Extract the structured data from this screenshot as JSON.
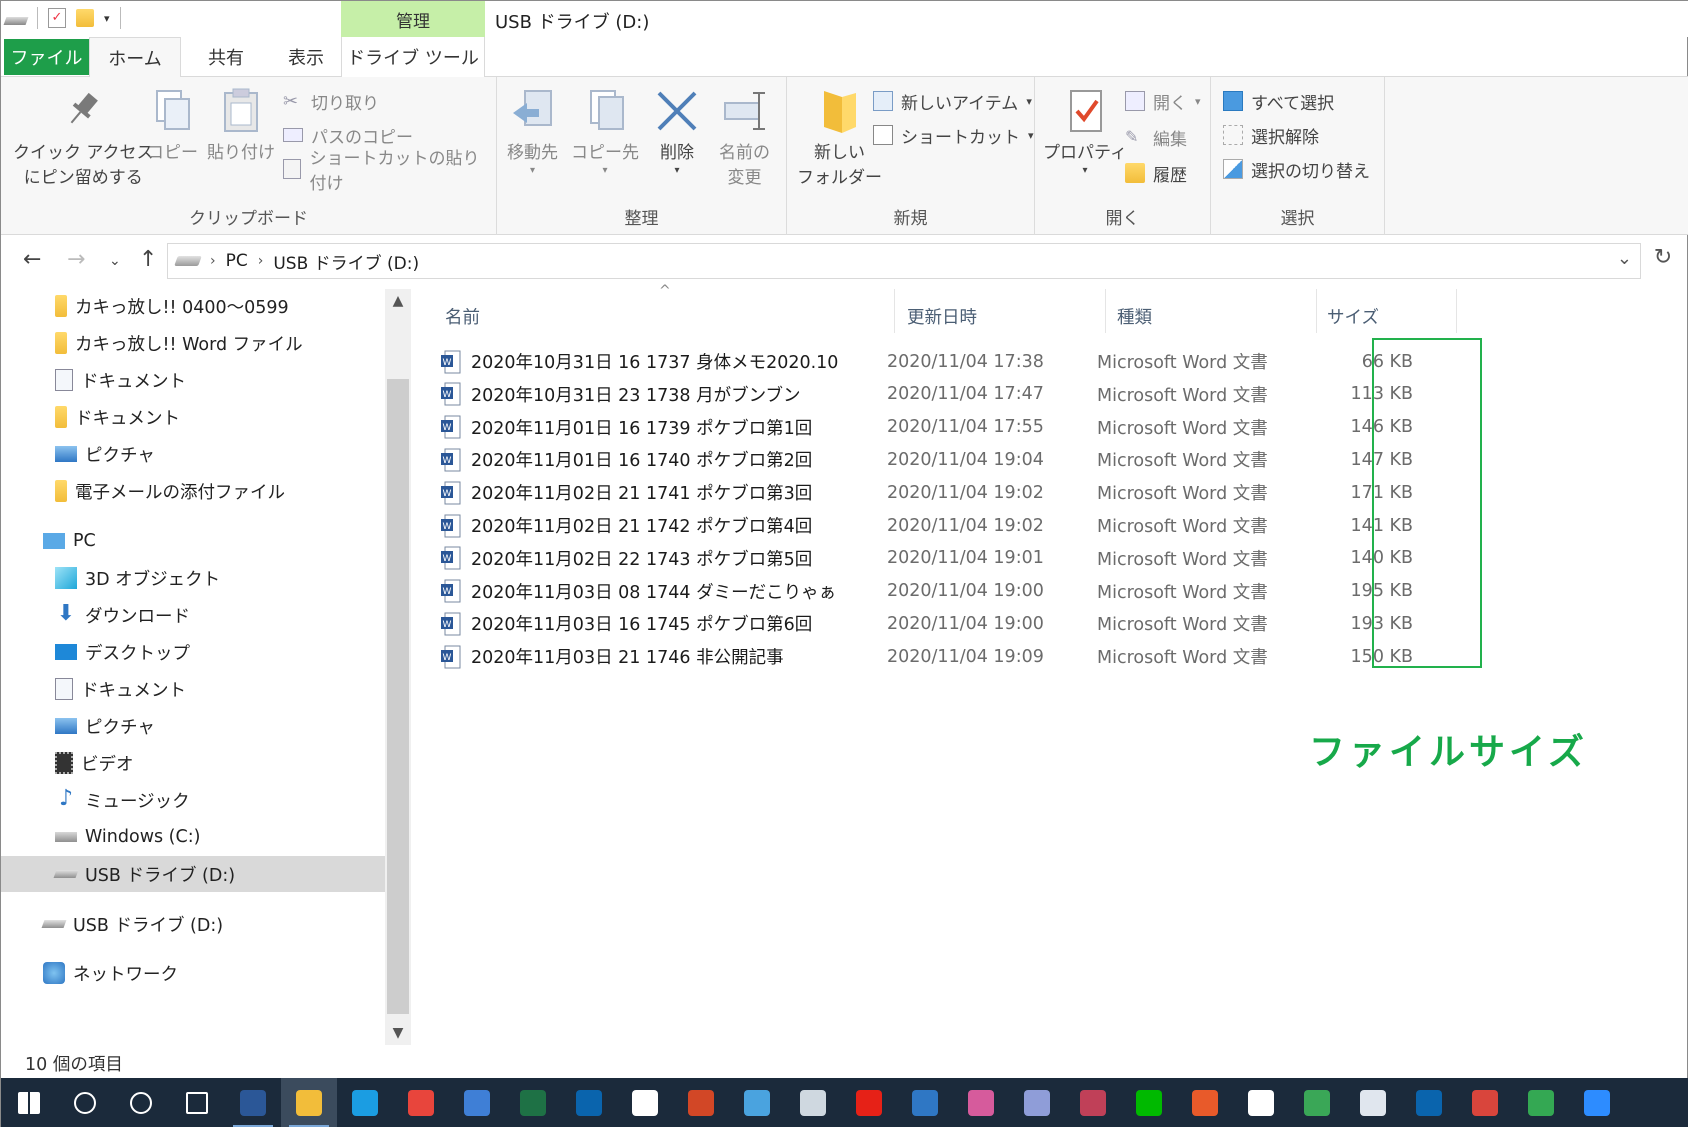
{
  "window": {
    "title": "USB ドライブ (D:)",
    "context_tab": "管理"
  },
  "tabs": {
    "file": "ファイル",
    "home": "ホーム",
    "share": "共有",
    "view": "表示",
    "drive_tools": "ドライブ ツール"
  },
  "ribbon": {
    "clipboard": {
      "pin_line1": "クイック アクセス",
      "pin_line2": "にピン留めする",
      "copy": "コピー",
      "paste": "貼り付け",
      "cut": "切り取り",
      "copy_path": "パスのコピー",
      "paste_shortcut": "ショートカットの貼り付け",
      "label": "クリップボード"
    },
    "organize": {
      "move_to": "移動先",
      "copy_to": "コピー先",
      "delete": "削除",
      "rename_line1": "名前の",
      "rename_line2": "変更",
      "label": "整理"
    },
    "new": {
      "new_folder_line1": "新しい",
      "new_folder_line2": "フォルダー",
      "new_item": "新しいアイテム",
      "shortcut": "ショートカット",
      "label": "新規"
    },
    "open": {
      "properties": "プロパティ",
      "open": "開く",
      "edit": "編集",
      "history": "履歴",
      "label": "開く"
    },
    "select": {
      "select_all": "すべて選択",
      "select_none": "選択解除",
      "invert": "選択の切り替え",
      "label": "選択"
    }
  },
  "address": {
    "crumbs": [
      "PC",
      "USB ドライブ (D:)"
    ]
  },
  "nav": {
    "items": [
      {
        "label": "カキっ放し!! 0400～0599",
        "icon": "folder-icon"
      },
      {
        "label": "カキっ放し!! Word ファイル",
        "icon": "folder-icon"
      },
      {
        "label": "ドキュメント",
        "icon": "document-icon"
      },
      {
        "label": "ドキュメント",
        "icon": "folder-icon"
      },
      {
        "label": "ピクチャ",
        "icon": "picture-icon"
      },
      {
        "label": "電子メールの添付ファイル",
        "icon": "folder-icon"
      },
      {
        "label": "PC",
        "icon": "pc-icon"
      },
      {
        "label": "3D オブジェクト",
        "icon": "cube-icon"
      },
      {
        "label": "ダウンロード",
        "icon": "download-icon"
      },
      {
        "label": "デスクトップ",
        "icon": "desktop-icon"
      },
      {
        "label": "ドキュメント",
        "icon": "document-icon"
      },
      {
        "label": "ピクチャ",
        "icon": "picture-icon"
      },
      {
        "label": "ビデオ",
        "icon": "video-icon"
      },
      {
        "label": "ミュージック",
        "icon": "music-icon"
      },
      {
        "label": "Windows (C:)",
        "icon": "windows-drive-icon"
      },
      {
        "label": "USB ドライブ (D:)",
        "icon": "usb-drive-icon"
      },
      {
        "label": "USB ドライブ (D:)",
        "icon": "usb-drive-icon"
      },
      {
        "label": "ネットワーク",
        "icon": "network-icon"
      }
    ]
  },
  "columns": {
    "name": "名前",
    "date": "更新日時",
    "type": "種類",
    "size": "サイズ"
  },
  "files": [
    {
      "name": "2020年10月31日 16 1737 身体メモ2020.10",
      "date": "2020/11/04 17:38",
      "type": "Microsoft Word 文書",
      "size": "66 KB"
    },
    {
      "name": "2020年10月31日 23 1738 月がブンブン",
      "date": "2020/11/04 17:47",
      "type": "Microsoft Word 文書",
      "size": "113 KB"
    },
    {
      "name": "2020年11月01日 16 1739 ポケブロ第1回",
      "date": "2020/11/04 17:55",
      "type": "Microsoft Word 文書",
      "size": "146 KB"
    },
    {
      "name": "2020年11月01日 16 1740 ポケブロ第2回",
      "date": "2020/11/04 19:04",
      "type": "Microsoft Word 文書",
      "size": "147 KB"
    },
    {
      "name": "2020年11月02日 21 1741 ポケブロ第3回",
      "date": "2020/11/04 19:02",
      "type": "Microsoft Word 文書",
      "size": "171 KB"
    },
    {
      "name": "2020年11月02日 21 1742 ポケブロ第4回",
      "date": "2020/11/04 19:02",
      "type": "Microsoft Word 文書",
      "size": "141 KB"
    },
    {
      "name": "2020年11月02日 22 1743 ポケブロ第5回",
      "date": "2020/11/04 19:01",
      "type": "Microsoft Word 文書",
      "size": "140 KB"
    },
    {
      "name": "2020年11月03日 08 1744 ダミーだこりゃぁ",
      "date": "2020/11/04 19:00",
      "type": "Microsoft Word 文書",
      "size": "195 KB"
    },
    {
      "name": "2020年11月03日 16 1745 ポケブロ第6回",
      "date": "2020/11/04 19:00",
      "type": "Microsoft Word 文書",
      "size": "193 KB"
    },
    {
      "name": "2020年11月03日 21 1746 非公開記事",
      "date": "2020/11/04 19:09",
      "type": "Microsoft Word 文書",
      "size": "150 KB"
    }
  ],
  "annotation": "ファイルサイズ",
  "status": "10 個の項目",
  "colors": {
    "file_tab": "#1e9e4a",
    "context_tab": "#c6efa8",
    "annotation": "#17a94a",
    "selection": "#d9d9d9",
    "taskbar": "#1b2a3b"
  },
  "taskbar": [
    "windows-start-icon",
    "search-icon",
    "cortana-icon",
    "task-view-icon",
    "word-icon",
    "file-explorer-icon",
    "edge-icon",
    "chrome-icon",
    "people-icon",
    "excel-icon",
    "outlook-icon",
    "amazon-icon",
    "powerpoint-icon",
    "calculator-icon",
    "printer-icon",
    "youtube-icon",
    "photos-icon",
    "paint-icon",
    "paint-3d-icon",
    "snip-icon",
    "line-icon",
    "game-icon",
    "google-icon",
    "maps-icon",
    "inbox-icon",
    "onedrive-icon",
    "pdf-png-icon",
    "play-store-icon",
    "zoom-icon"
  ]
}
